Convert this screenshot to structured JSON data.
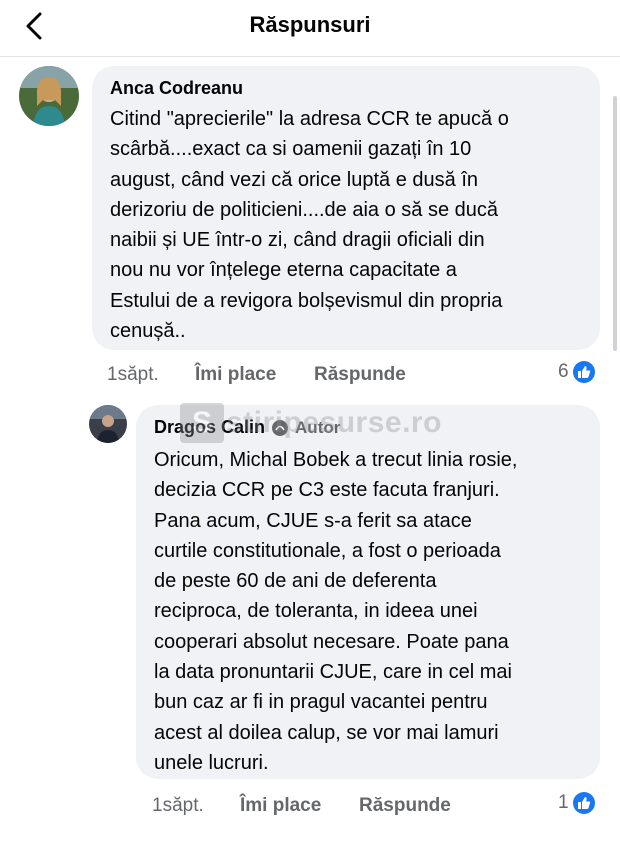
{
  "header": {
    "title": "Răspunsuri",
    "back_icon": "chevron-left-icon"
  },
  "comments": [
    {
      "author": "Anca Codreanu",
      "lines": [
        "Citind \"aprecierile\" la adresa CCR te apucă o",
        "scârbă....exact ca si oamenii gazați în 10",
        "august, când vezi că orice luptă e dusă în",
        "derizoriu de politicieni....de aia o să se ducă",
        "naibii și UE într-o zi, când dragii oficiali din",
        "nou nu vor înțelege eterna capacitate a",
        "Estului de a revigora bolșevismul din propria",
        "cenușă.."
      ],
      "time": "1săpt.",
      "like_label": "Îmi place",
      "reply_label": "Răspunde",
      "reaction_count": "6"
    },
    {
      "author": "Dragos Calin",
      "author_badge": "Autor",
      "lines": [
        "Oricum, Michal Bobek a trecut linia rosie,",
        "decizia CCR pe C3 este facuta franjuri.",
        "Pana acum, CJUE s-a ferit sa atace",
        "curtile constitutionale, a fost o perioada",
        "de peste 60 de ani de deferenta",
        "reciproca, de toleranta, in ideea unei",
        "cooperari absolut necesare. Poate pana",
        "la data pronuntarii CJUE, care in cel mai",
        "bun caz ar fi in pragul vacantei pentru",
        "acest al doilea calup, se vor mai lamuri",
        "unele lucruri."
      ],
      "time": "1săpt.",
      "like_label": "Îmi place",
      "reply_label": "Răspunde",
      "reaction_count": "1"
    }
  ],
  "watermark": {
    "letter": "S",
    "text": "stiripesurse.ro"
  },
  "colors": {
    "accent": "#1877f2",
    "bubble": "#f0f2f5",
    "muted": "#65676b"
  }
}
